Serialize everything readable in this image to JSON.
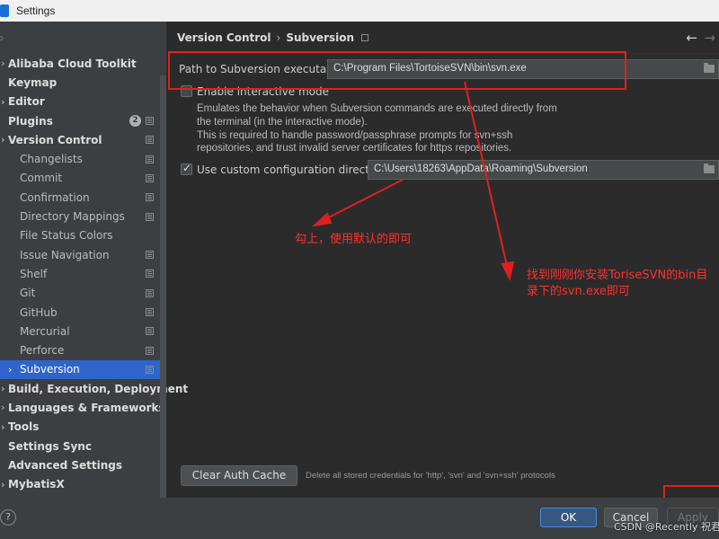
{
  "window": {
    "title": "Settings"
  },
  "sidebar": {
    "items": [
      {
        "label": "Alibaba Cloud Toolkit",
        "level": "top",
        "chevron": true
      },
      {
        "label": "Keymap",
        "level": "top"
      },
      {
        "label": "Editor",
        "level": "top",
        "chevron": true
      },
      {
        "label": "Plugins",
        "level": "top",
        "badge": "2",
        "project": true
      },
      {
        "label": "Version Control",
        "level": "top",
        "chevron": true,
        "project": true
      },
      {
        "label": "Changelists",
        "level": "child",
        "project": true
      },
      {
        "label": "Commit",
        "level": "child",
        "project": true
      },
      {
        "label": "Confirmation",
        "level": "child",
        "project": true
      },
      {
        "label": "Directory Mappings",
        "level": "child",
        "project": true
      },
      {
        "label": "File Status Colors",
        "level": "child"
      },
      {
        "label": "Issue Navigation",
        "level": "child",
        "project": true
      },
      {
        "label": "Shelf",
        "level": "child",
        "project": true
      },
      {
        "label": "Git",
        "level": "child",
        "project": true
      },
      {
        "label": "GitHub",
        "level": "child",
        "project": true
      },
      {
        "label": "Mercurial",
        "level": "child",
        "project": true
      },
      {
        "label": "Perforce",
        "level": "child",
        "project": true
      },
      {
        "label": "Subversion",
        "level": "child",
        "chevron": true,
        "project": true,
        "selected": true
      },
      {
        "label": "Build, Execution, Deployment",
        "level": "top",
        "chevron": true
      },
      {
        "label": "Languages & Frameworks",
        "level": "top",
        "chevron": true
      },
      {
        "label": "Tools",
        "level": "top",
        "chevron": true
      },
      {
        "label": "Settings Sync",
        "level": "top"
      },
      {
        "label": "Advanced Settings",
        "level": "top"
      },
      {
        "label": "MybatisX",
        "level": "top",
        "chevron": true
      }
    ]
  },
  "header": {
    "crumb1": "Version Control",
    "separator": "›",
    "crumb2": "Subversion",
    "back_icon": "←",
    "forward_icon": "→"
  },
  "form": {
    "path_label": "Path to Subversion executable:",
    "path_value": "C:\\Program Files\\TortoiseSVN\\bin\\svn.exe",
    "interactive_label": "Enable interactive mode",
    "interactive_checked": false,
    "desc_line1": "Emulates the behavior when Subversion commands are executed directly from",
    "desc_line2": "the terminal (in the interactive mode).",
    "desc_line3": "This is required to handle password/passphrase prompts for svn+ssh",
    "desc_line4": "repositories, and trust invalid server certificates for https repositories.",
    "custom_dir_label": "Use custom configuration directory:",
    "custom_dir_checked": true,
    "custom_dir_value": "C:\\Users\\18263\\AppData\\Roaming\\Subversion",
    "clear_cache_label": "Clear Auth Cache",
    "clear_cache_desc": "Delete all stored credentials for 'http', 'svn' and 'svn+ssh' protocols"
  },
  "annotations": {
    "note1": "勾上，使用默认的即可",
    "note2_line1": "找到刚刚你安装ToriseSVN的bin目",
    "note2_line2": "录下的svn.exe即可",
    "color": "#e02020"
  },
  "footer": {
    "ok": "OK",
    "cancel": "Cancel",
    "apply": "Apply",
    "help": "?",
    "watermark": "CSDN @Recently 祝君"
  },
  "colors": {
    "selected": "#2f65ca",
    "ok_button": "#365880",
    "annotation": "#e02020"
  }
}
